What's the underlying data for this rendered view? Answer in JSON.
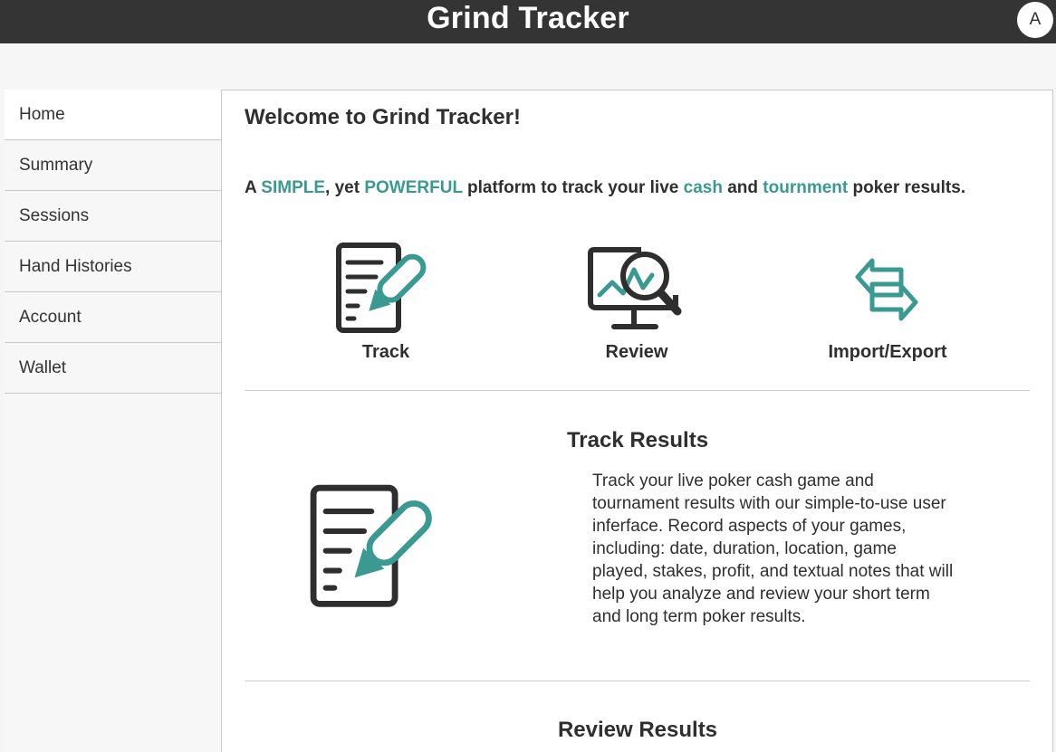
{
  "header": {
    "title": "Grind Tracker",
    "avatar_initial": "A"
  },
  "sidebar": {
    "items": [
      {
        "label": "Home",
        "active": true
      },
      {
        "label": "Summary"
      },
      {
        "label": "Sessions"
      },
      {
        "label": "Hand Histories"
      },
      {
        "label": "Account"
      },
      {
        "label": "Wallet"
      }
    ]
  },
  "main": {
    "welcome": "Welcome to Grind Tracker!",
    "tagline": {
      "p1": "A ",
      "simple": "SIMPLE",
      "p2": ", yet ",
      "powerful": "POWERFUL",
      "p3": " platform to track your live ",
      "cash": "cash",
      "p4": " and ",
      "tournament": "tournment",
      "p5": " poker results."
    },
    "features": [
      {
        "label": "Track",
        "icon": "document-pencil-icon"
      },
      {
        "label": "Review",
        "icon": "monitor-magnifier-icon"
      },
      {
        "label": "Import/Export",
        "icon": "exchange-arrows-icon"
      }
    ],
    "sections": [
      {
        "title": "Track Results",
        "icon": "document-pencil-icon",
        "text": "Track your live poker cash game and tournament results with our simple-to-use user inferface. Record aspects of your games, including: date, duration, location, game played, stakes, profit, and textual notes that will help you analyze and review your short term and long term poker results."
      },
      {
        "title": "Review Results"
      }
    ]
  },
  "colors": {
    "header_bg": "#343434",
    "accent": "#3a9a92",
    "text": "#2f2f2f"
  }
}
